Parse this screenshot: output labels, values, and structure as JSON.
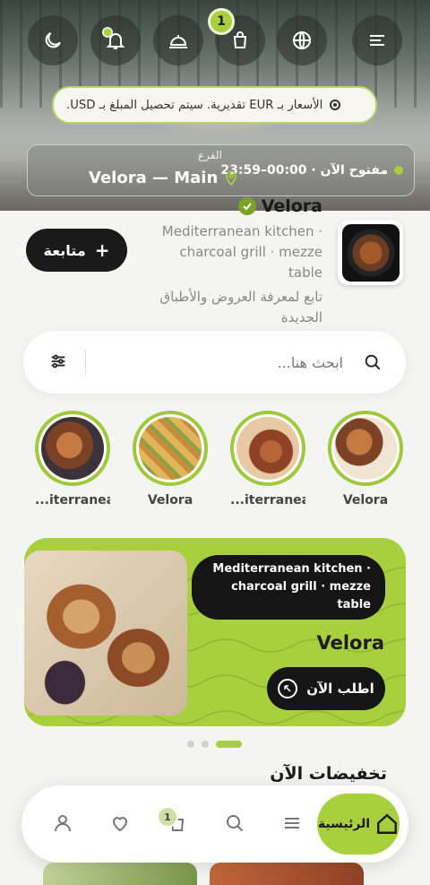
{
  "header": {
    "cart_count": "1",
    "notice_text": "الأسعار بـ EUR تقديرية. سيتم تحصيل المبلغ بـ USD.",
    "open_status": "مفتوح الآن · 00:00–23:59",
    "branch_label": "الفرع",
    "branch_name": "Velora — Main",
    "icons": [
      "dark-mode-icon",
      "notification-bell-icon",
      "cloche-icon",
      "shopping-bag-icon",
      "globe-icon",
      "menu-icon"
    ]
  },
  "restaurant": {
    "name": "Velora",
    "description": "Mediterranean kitchen · charcoal grill · mezze table",
    "follow_hint": "تابع لمعرفة العروض والأطباق الجديدة",
    "follow_label": "متابعة"
  },
  "search": {
    "placeholder": "ابحث هنا..."
  },
  "categories": [
    {
      "label": "Velora"
    },
    {
      "label": "...iterranean"
    },
    {
      "label": "Velora"
    },
    {
      "label": "...iterranean"
    }
  ],
  "banner": {
    "tag_text": "Mediterranean kitchen · charcoal grill · mezze table",
    "title": "Velora",
    "order_label": "اطلب الآن"
  },
  "section": {
    "title": "تخفيضات الآن"
  },
  "bottom_nav": {
    "home_label": "الرئيسية",
    "cart_badge": "1"
  },
  "colors": {
    "accent": "#a8cf3d",
    "dark": "#151515",
    "background": "#f4f4f2"
  }
}
